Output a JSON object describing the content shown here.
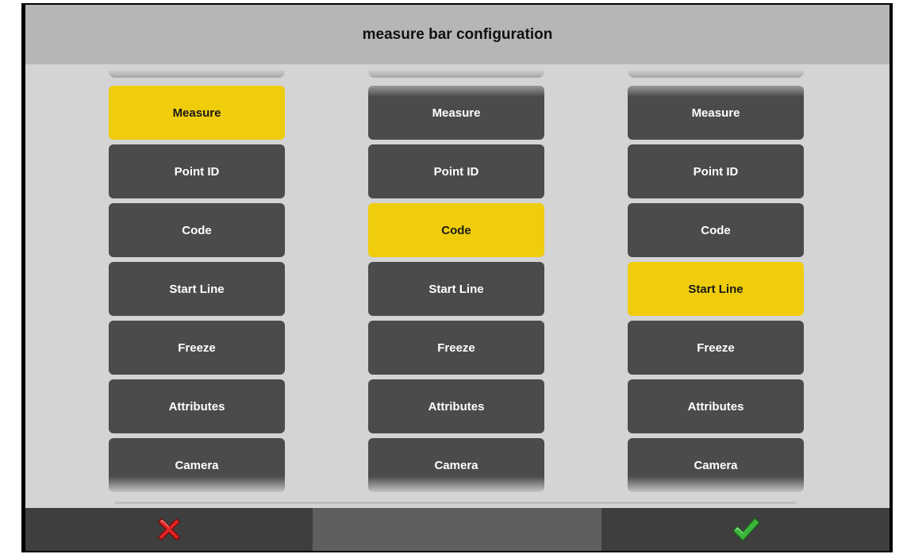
{
  "header": {
    "title": "measure bar configuration"
  },
  "columns": [
    {
      "options": [
        "Measure",
        "Point ID",
        "Code",
        "Start Line",
        "Freeze",
        "Attributes",
        "Camera"
      ],
      "selected": "Measure"
    },
    {
      "options": [
        "Measure",
        "Point ID",
        "Code",
        "Start Line",
        "Freeze",
        "Attributes",
        "Camera"
      ],
      "selected": "Code"
    },
    {
      "options": [
        "Measure",
        "Point ID",
        "Code",
        "Start Line",
        "Freeze",
        "Attributes",
        "Camera"
      ],
      "selected": "Start Line"
    }
  ],
  "footer": {
    "cancel_icon": "close-icon",
    "confirm_icon": "checkmark-icon"
  },
  "colors": {
    "selected": "#efcd0d",
    "option": "#4b4b4b",
    "cancel": "#e02020",
    "confirm": "#3cb53c"
  }
}
